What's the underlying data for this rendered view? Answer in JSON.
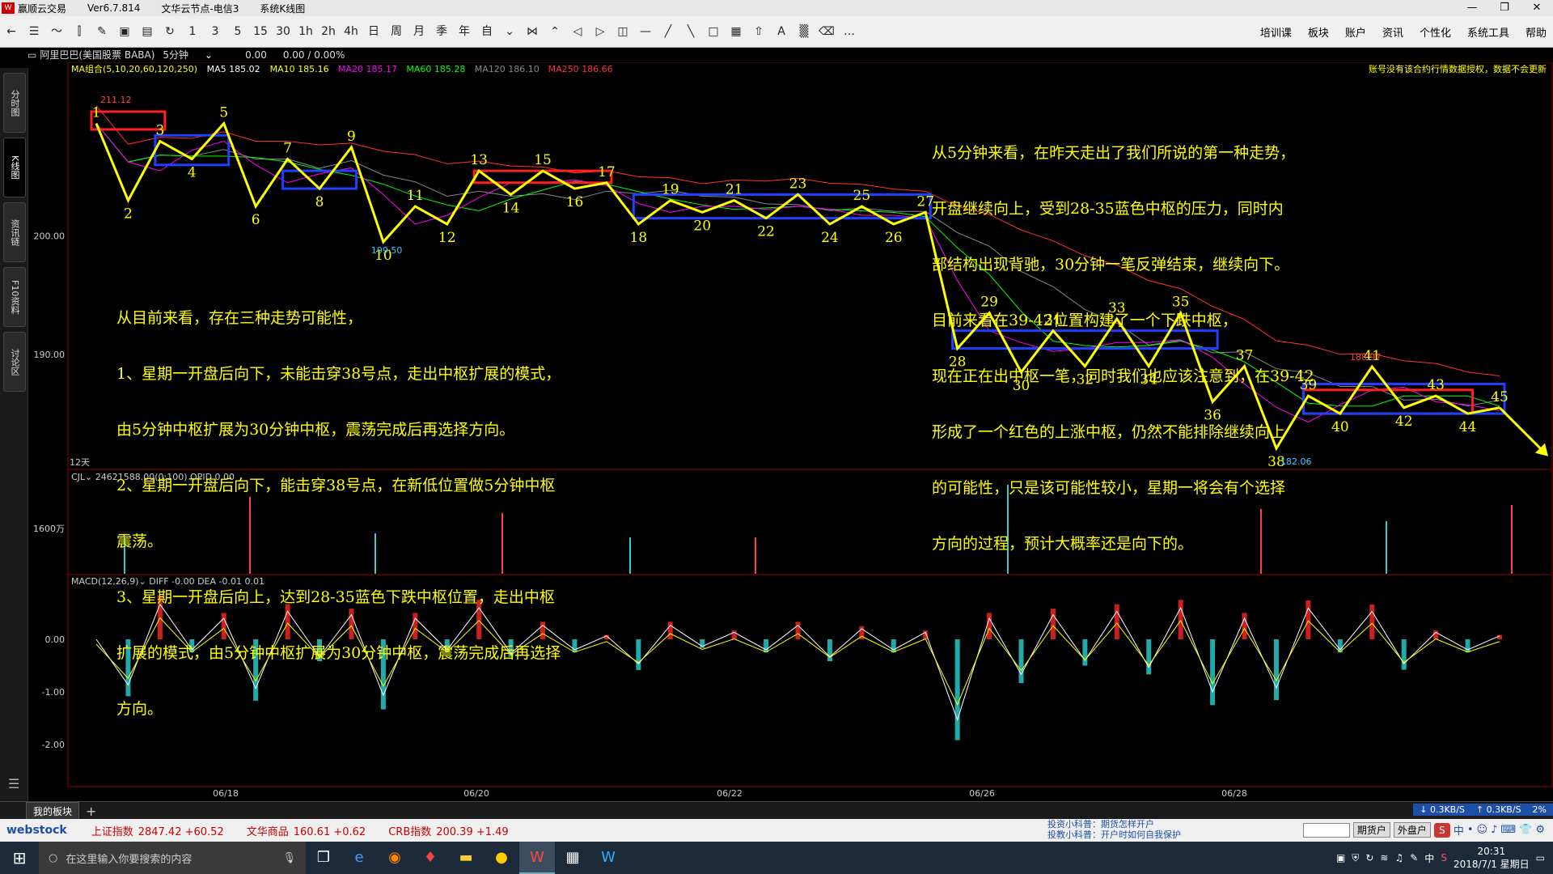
{
  "window": {
    "app_name": "赢顺云交易",
    "version": "Ver6.7.814",
    "server": "文华云节点-电信3",
    "mode": "系统K线图",
    "controls": [
      "—",
      "❐",
      "✕"
    ]
  },
  "toolbar": {
    "periods": [
      "1",
      "3",
      "5",
      "15",
      "30",
      "1h",
      "2h",
      "4h",
      "日",
      "周",
      "月",
      "季",
      "年",
      "自"
    ],
    "menu": [
      "培训课",
      "板块",
      "账户",
      "资讯",
      "个性化",
      "系统工具",
      "帮助"
    ]
  },
  "sidebar": {
    "tabs": [
      "分时图",
      "K线图",
      "资讯链",
      "F10资料",
      "讨论区"
    ],
    "active": 1
  },
  "security": {
    "name": "阿里巴巴(美国股票 BABA)",
    "period": "5分钟",
    "price": "0.00",
    "change": "0.00 / 0.00%"
  },
  "ma_legend": [
    {
      "label": "MA组合(5,10,20,60,120,250)",
      "color": "#ffff00"
    },
    {
      "label": "MA5 185.02",
      "color": "#ffffff"
    },
    {
      "label": "MA10 185.16",
      "color": "#ffff00"
    },
    {
      "label": "MA20 185.17",
      "color": "#ff00ff"
    },
    {
      "label": "MA60 185.28",
      "color": "#00ff00"
    },
    {
      "label": "MA120 186.10",
      "color": "#888888"
    },
    {
      "label": "MA250 186.66",
      "color": "#ff3030"
    }
  ],
  "warning": "账号没有该合约行情数据授权，数据不会更新",
  "price_axis": {
    "labels": [
      "200.00",
      "190.00"
    ],
    "range": [
      182,
      212
    ]
  },
  "price_markers": {
    "high": "211.12",
    "low_1": "199.50",
    "low_2": "182.06",
    "high_2": "188.97"
  },
  "days_label": "12天",
  "volume": {
    "legend": "CJL",
    "value": "24621588.00(0:100)",
    "opid": "OPID 0.00",
    "axis_label": "1600万"
  },
  "macd": {
    "legend": "MACD(12,26,9)",
    "diff": "DIFF -0.00",
    "dea": "DEA -0.01",
    "macd_val": "0.01",
    "axis_labels": [
      "0.00",
      "-1.00",
      "-2.00"
    ]
  },
  "date_axis": [
    "06/18",
    "06/20",
    "06/22",
    "06/26",
    "06/28"
  ],
  "chart_data": {
    "type": "line",
    "title": "阿里巴巴(美国股票 BABA) 5分钟",
    "xlabel": "",
    "ylabel": "",
    "ylim": [
      182,
      212
    ],
    "wave_points": [
      {
        "n": "1",
        "y": 209.5
      },
      {
        "n": "2",
        "y": 203.0
      },
      {
        "n": "3",
        "y": 208.0
      },
      {
        "n": "4",
        "y": 206.5
      },
      {
        "n": "5",
        "y": 209.5
      },
      {
        "n": "6",
        "y": 202.5
      },
      {
        "n": "7",
        "y": 206.5
      },
      {
        "n": "8",
        "y": 204.0
      },
      {
        "n": "9",
        "y": 207.5
      },
      {
        "n": "10",
        "y": 199.5
      },
      {
        "n": "11",
        "y": 202.5
      },
      {
        "n": "12",
        "y": 201.0
      },
      {
        "n": "13",
        "y": 205.5
      },
      {
        "n": "14",
        "y": 203.5
      },
      {
        "n": "15",
        "y": 205.5
      },
      {
        "n": "16",
        "y": 204.0
      },
      {
        "n": "17",
        "y": 204.5
      },
      {
        "n": "18",
        "y": 201.0
      },
      {
        "n": "19",
        "y": 203.0
      },
      {
        "n": "20",
        "y": 202.0
      },
      {
        "n": "21",
        "y": 203.0
      },
      {
        "n": "22",
        "y": 201.5
      },
      {
        "n": "23",
        "y": 203.5
      },
      {
        "n": "24",
        "y": 201.0
      },
      {
        "n": "25",
        "y": 202.5
      },
      {
        "n": "26",
        "y": 201.0
      },
      {
        "n": "27",
        "y": 202.0
      },
      {
        "n": "28",
        "y": 190.5
      },
      {
        "n": "29",
        "y": 193.5
      },
      {
        "n": "30",
        "y": 188.5
      },
      {
        "n": "31",
        "y": 192.0
      },
      {
        "n": "32",
        "y": 189.0
      },
      {
        "n": "33",
        "y": 193.0
      },
      {
        "n": "34",
        "y": 189.0
      },
      {
        "n": "35",
        "y": 193.5
      },
      {
        "n": "36",
        "y": 186.0
      },
      {
        "n": "37",
        "y": 189.0
      },
      {
        "n": "38",
        "y": 182.06
      },
      {
        "n": "39",
        "y": 186.5
      },
      {
        "n": "40",
        "y": 185.0
      },
      {
        "n": "41",
        "y": 188.97
      },
      {
        "n": "42",
        "y": 185.5
      },
      {
        "n": "43",
        "y": 186.5
      },
      {
        "n": "44",
        "y": 185.0
      },
      {
        "n": "45",
        "y": 185.5
      }
    ],
    "centers": [
      {
        "color": "red",
        "range": [
          209.0,
          210.5
        ]
      },
      {
        "color": "blue",
        "range": [
          206.0,
          208.5
        ]
      },
      {
        "color": "blue",
        "range": [
          204.0,
          205.5
        ]
      },
      {
        "color": "red",
        "range": [
          204.5,
          205.5
        ]
      },
      {
        "color": "blue",
        "range": [
          201.5,
          203.5
        ]
      },
      {
        "color": "blue",
        "range": [
          190.5,
          192.0
        ]
      },
      {
        "color": "red",
        "range": [
          185.0,
          187.0
        ]
      },
      {
        "color": "blue",
        "range": [
          185.0,
          187.5
        ]
      }
    ]
  },
  "annotations": {
    "right": [
      "从5分钟来看，在昨天走出了我们所说的第一种走势，",
      "开盘继续向上，受到28-35蓝色中枢的压力，同时内",
      "部结构出现背驰，30分钟一笔反弹结束，继续向下。",
      "目前来看在39-42位置构建了一个下跌中枢，",
      "现在正在出中枢一笔，同时我们也应该注意到，在39-42",
      "形成了一个红色的上涨中枢，仍然不能排除继续向上",
      "的可能性，只是该可能性较小，星期一将会有个选择",
      "方向的过程，预计大概率还是向下的。"
    ],
    "left": [
      "从目前来看，存在三种走势可能性，",
      "1、星期一开盘后向下，未能击穿38号点，走出中枢扩展的模式，",
      "由5分钟中枢扩展为30分钟中枢，震荡完成后再选择方向。",
      "2、星期一开盘后向下，能击穿38号点，在新低位置做5分钟中枢",
      "震荡。",
      "3、星期一开盘后向上，达到28-35蓝色下跌中枢位置，走出中枢",
      "扩展的模式，由5分钟中枢扩展为30分钟中枢，震荡完成后再选择",
      "方向。"
    ]
  },
  "bottom": {
    "tab": "我的板块",
    "net_down": "↓ 0.3KB/S",
    "net_up": "↑ 0.3KB/S",
    "net_pct": "2%"
  },
  "indices": [
    {
      "name": "上证指数",
      "value": "2847.42 +60.52"
    },
    {
      "name": "文华商品",
      "value": "160.61 +0.62"
    },
    {
      "name": "CRB指数",
      "value": "200.39 +1.49"
    }
  ],
  "index_logo": "webstock",
  "index_buttons": [
    "期货户",
    "外盘户"
  ],
  "news": [
    "投资小科普：期货怎样开户",
    "投教小科普：开户时如何自我保护"
  ],
  "taskbar": {
    "search_placeholder": "在这里输入你要搜索的内容",
    "time": "20:31",
    "date": "2018/7/1 星期日",
    "ime": "中"
  }
}
